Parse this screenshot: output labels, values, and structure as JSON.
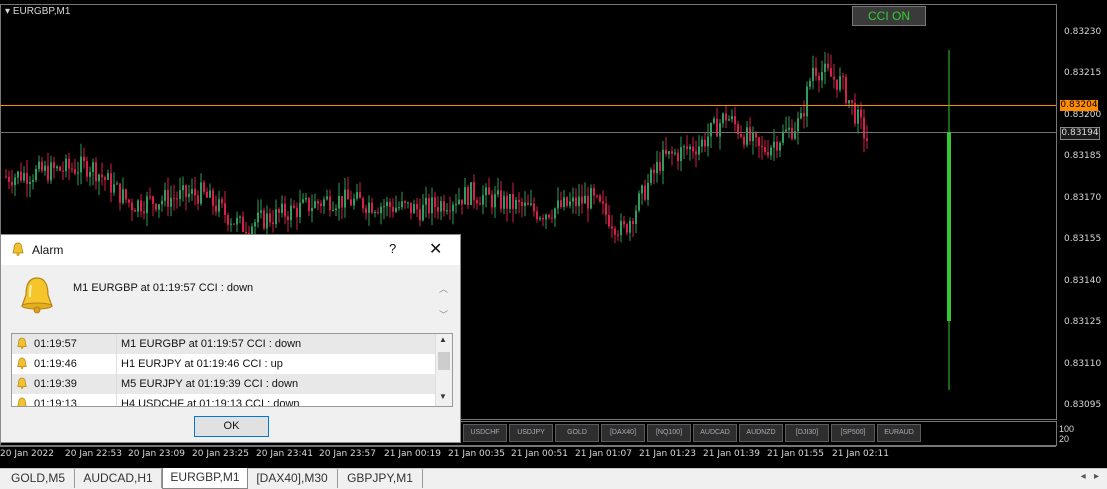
{
  "chart": {
    "symbol_title": "EURGBP,M1",
    "cci_button": "CCI ON",
    "price_labels": [
      "0.83230",
      "0.83215",
      "0.83200",
      "0.83185",
      "0.83170",
      "0.83155",
      "0.83140",
      "0.83125",
      "0.83110",
      "0.83095"
    ],
    "price_values": [
      0.8323,
      0.83215,
      0.832,
      0.83185,
      0.8317,
      0.83155,
      0.8314,
      0.83125,
      0.8311,
      0.83095
    ],
    "ask_line": {
      "label": "0.83204",
      "value": 0.83204,
      "color": "#ff8c00"
    },
    "bid_line": {
      "label": "0.83194",
      "value": 0.83194,
      "color": "#808080"
    },
    "time_labels": [
      "20 Jan 2022",
      "20 Jan 22:53",
      "20 Jan 23:09",
      "20 Jan 23:25",
      "20 Jan 23:41",
      "20 Jan 23:57",
      "21 Jan 00:19",
      "21 Jan 00:35",
      "21 Jan 00:51",
      "21 Jan 01:07",
      "21 Jan 01:23",
      "21 Jan 01:39",
      "21 Jan 01:55",
      "21 Jan 02:11"
    ],
    "bull_color": "#2e9e5a",
    "bear_color": "#d4204a",
    "signal_bar_color": "#34c934",
    "symbol_buttons": [
      "USDCHF",
      "USDJPY",
      "GOLD",
      "[DAX40]",
      "[NQ100]",
      "AUDCAD",
      "AUDNZD",
      "[DJI30]",
      "[SP500]",
      "EURAUD"
    ],
    "indicator_scale": [
      "100",
      "20"
    ]
  },
  "dialog": {
    "title": "Alarm",
    "help": "?",
    "close": "✕",
    "message": "M1 EURGBP at 01:19:57 CCI   : down",
    "rows": [
      {
        "time": "01:19:57",
        "message": "M1 EURGBP at 01:19:57 CCI   : down"
      },
      {
        "time": "01:19:46",
        "message": "H1 EURJPY at 01:19:46 CCI   : up"
      },
      {
        "time": "01:19:39",
        "message": "M5 EURJPY at 01:19:39 CCI   : down"
      },
      {
        "time": "01:19:13",
        "message": "H4 USDCHF at 01:19:13 CCI   : down"
      }
    ],
    "ok_label": "OK"
  },
  "tabs": [
    {
      "label": "GOLD,M5"
    },
    {
      "label": "AUDCAD,H1"
    },
    {
      "label": "EURGBP,M1",
      "active": true
    },
    {
      "label": "[DAX40],M30"
    },
    {
      "label": "GBPJPY,M1"
    }
  ]
}
